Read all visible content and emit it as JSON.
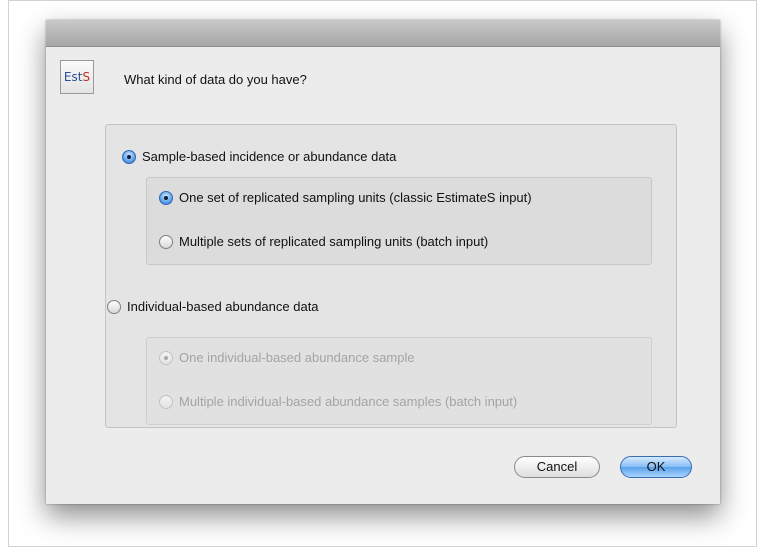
{
  "dialog": {
    "app_icon_text_part1": "Est",
    "app_icon_text_part2": "S",
    "prompt": "What kind of data do you have?"
  },
  "options": {
    "sample_based": {
      "label": "Sample-based incidence or abundance data",
      "selected": true,
      "sub_options": [
        {
          "label": "One set of replicated sampling units (classic EstimateS input)",
          "selected": true
        },
        {
          "label": "Multiple sets of replicated sampling units (batch input)",
          "selected": false
        }
      ]
    },
    "individual_based": {
      "label": "Individual-based abundance data",
      "selected": false,
      "sub_options": [
        {
          "label": "One individual-based abundance sample",
          "selected": true,
          "disabled": true
        },
        {
          "label": "Multiple individual-based abundance samples (batch input)",
          "selected": false,
          "disabled": true
        }
      ]
    }
  },
  "buttons": {
    "cancel": "Cancel",
    "ok": "OK"
  },
  "colors": {
    "accent": "#5aa1ea",
    "dialog_bg": "#ececec",
    "disabled_text": "#a4a4a4",
    "icon_est": "#2a4f9a",
    "icon_s": "#c2311d"
  }
}
